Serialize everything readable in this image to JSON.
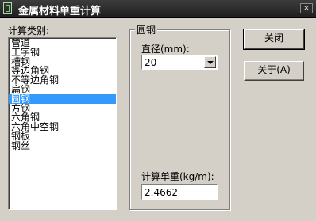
{
  "window": {
    "title": "金属材料单重计算",
    "close_glyph": "×"
  },
  "left": {
    "label": "计算类别:",
    "items": [
      "管道",
      "工字钢",
      "槽钢",
      "等边角钢",
      "不等边角钢",
      "扁钢",
      "圆钢",
      "方钢",
      "六角钢",
      "六角中空钢",
      "钢板",
      "钢丝"
    ],
    "selected_index": 6
  },
  "group": {
    "title": "圆钢",
    "diameter_label": "直径(mm):",
    "diameter_value": "20",
    "result_label": "计算单重(kg/m):",
    "result_value": "2.4662"
  },
  "buttons": {
    "close_label": "关闭",
    "about_label": "关于(A)"
  }
}
